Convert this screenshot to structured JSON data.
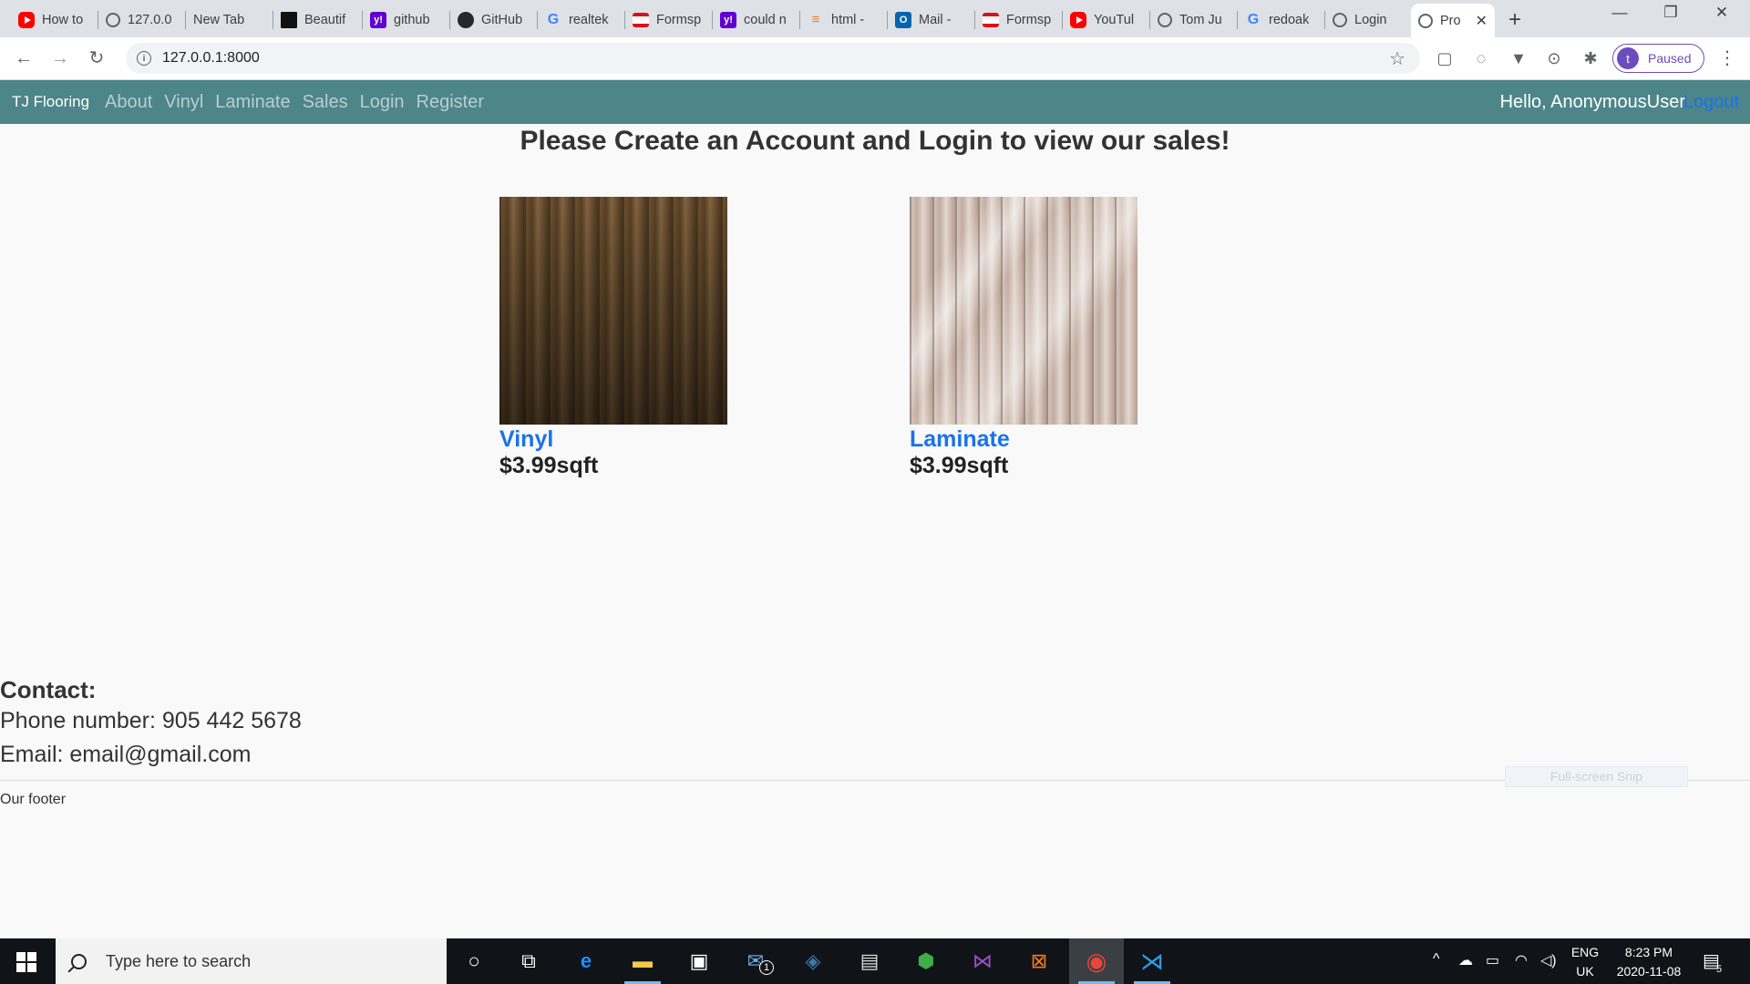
{
  "browser": {
    "tabs": [
      {
        "title": "How to",
        "icon": "youtube-icon"
      },
      {
        "title": "127.0.0",
        "icon": "globe-icon"
      },
      {
        "title": "New Tab",
        "icon": ""
      },
      {
        "title": "Beautif",
        "icon": "beautify-icon"
      },
      {
        "title": "github",
        "icon": "yahoo-icon"
      },
      {
        "title": "GitHub",
        "icon": "github-icon"
      },
      {
        "title": "realtek",
        "icon": "google-icon"
      },
      {
        "title": "Formsp",
        "icon": "formspree-icon"
      },
      {
        "title": "could n",
        "icon": "yahoo-icon"
      },
      {
        "title": "html -",
        "icon": "stackoverflow-icon"
      },
      {
        "title": "Mail -",
        "icon": "outlook-icon"
      },
      {
        "title": "Formsp",
        "icon": "formspree-icon"
      },
      {
        "title": "YouTul",
        "icon": "youtube-icon"
      },
      {
        "title": "Tom Ju",
        "icon": "globe-icon"
      },
      {
        "title": "redoak",
        "icon": "google-icon"
      },
      {
        "title": "Login",
        "icon": "globe-icon"
      },
      {
        "title": "Pro",
        "icon": "globe-icon",
        "active": true
      }
    ],
    "url": "127.0.0.1:8000",
    "profile_initial": "t",
    "profile_status": "Paused"
  },
  "site": {
    "brand": "TJ Flooring",
    "nav": [
      "About",
      "Vinyl",
      "Laminate",
      "Sales",
      "Login",
      "Register"
    ],
    "greeting": "Hello, AnonymousUser",
    "logout": "Logout",
    "heading": "Please Create an Account and Login to view our sales!",
    "products": [
      {
        "name": "Vinyl",
        "price": "$3.99sqft"
      },
      {
        "name": "Laminate",
        "price": "$3.99sqft"
      }
    ],
    "contact": {
      "title": "Contact:",
      "phone": "Phone number: 905 442 5678",
      "email": "Email: email@gmail.com"
    },
    "footer": "Our footer",
    "snip_overlay": "Full-screen Snip"
  },
  "taskbar": {
    "search_placeholder": "Type here to search",
    "mail_badge": "1",
    "lang_top": "ENG",
    "lang_bottom": "UK",
    "time": "8:23 PM",
    "date": "2020-11-08",
    "notifications": "5"
  },
  "colors": {
    "navbar": "#4d8589",
    "link": "#1a73e8",
    "profile": "#6d4cbd"
  }
}
